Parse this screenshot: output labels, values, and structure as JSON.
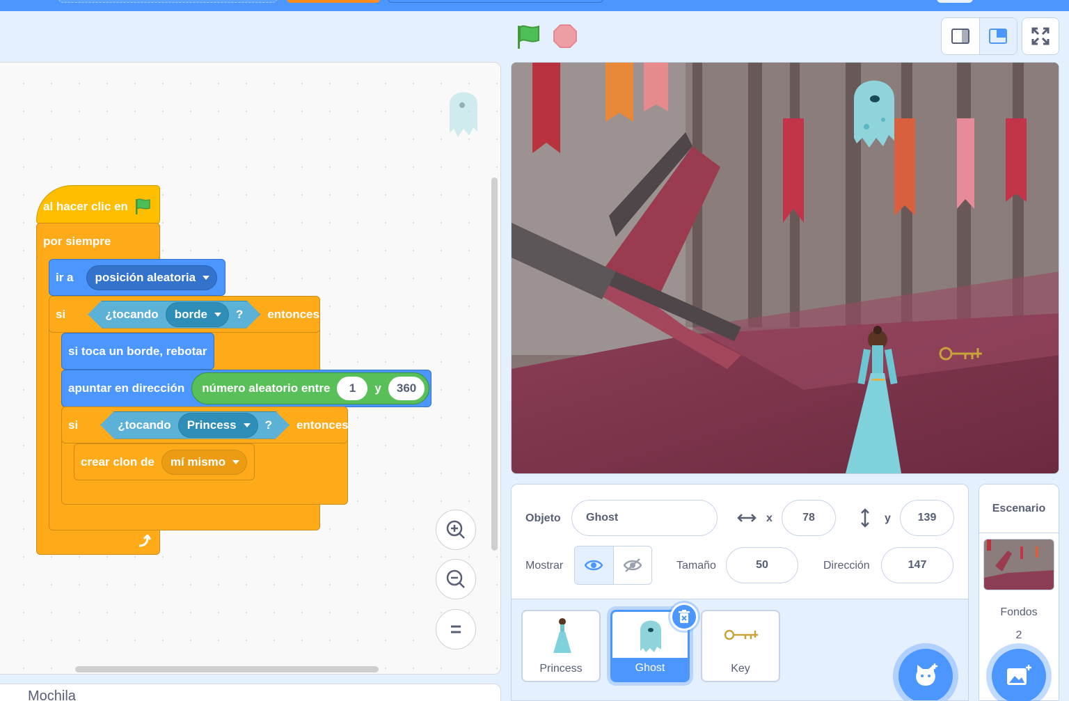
{
  "header": {
    "green_flag_icon": "green-flag-icon",
    "stop_icon": "stop-icon"
  },
  "code": {
    "hat_label": "al hacer clic en",
    "forever_label": "por siempre",
    "goto_label": "ir a",
    "goto_target": "posición aleatoria",
    "if1_label": "si",
    "touching_label": "¿tocando",
    "touching1_target": "borde",
    "question_mark": "?",
    "then_label": "entonces",
    "bounce_label": "si toca un borde, rebotar",
    "point_label": "apuntar en dirección",
    "random_label": "número aleatorio entre",
    "random_from": "1",
    "random_and": "y",
    "random_to": "360",
    "if2_label": "si",
    "touching2_target": "Princess",
    "clone_label": "crear clon de",
    "clone_target": "mí mismo"
  },
  "sprite_info": {
    "object_label": "Objeto",
    "sprite_name": "Ghost",
    "x_label": "x",
    "x_value": "78",
    "y_label": "y",
    "y_value": "139",
    "show_label": "Mostrar",
    "size_label": "Tamaño",
    "size_value": "50",
    "direction_label": "Dirección",
    "direction_value": "147"
  },
  "sprites": [
    {
      "name": "Princess"
    },
    {
      "name": "Ghost",
      "selected": true
    },
    {
      "name": "Key"
    }
  ],
  "stage_pane": {
    "title": "Escenario",
    "backdrops_label": "Fondos",
    "backdrops_count": "2"
  },
  "backpack": {
    "label": "Mochila"
  },
  "colors": {
    "motion": "#4c97ff",
    "control": "#ffab19",
    "events": "#ffbf00",
    "sensing": "#5cb1d6",
    "operators": "#59c059"
  }
}
